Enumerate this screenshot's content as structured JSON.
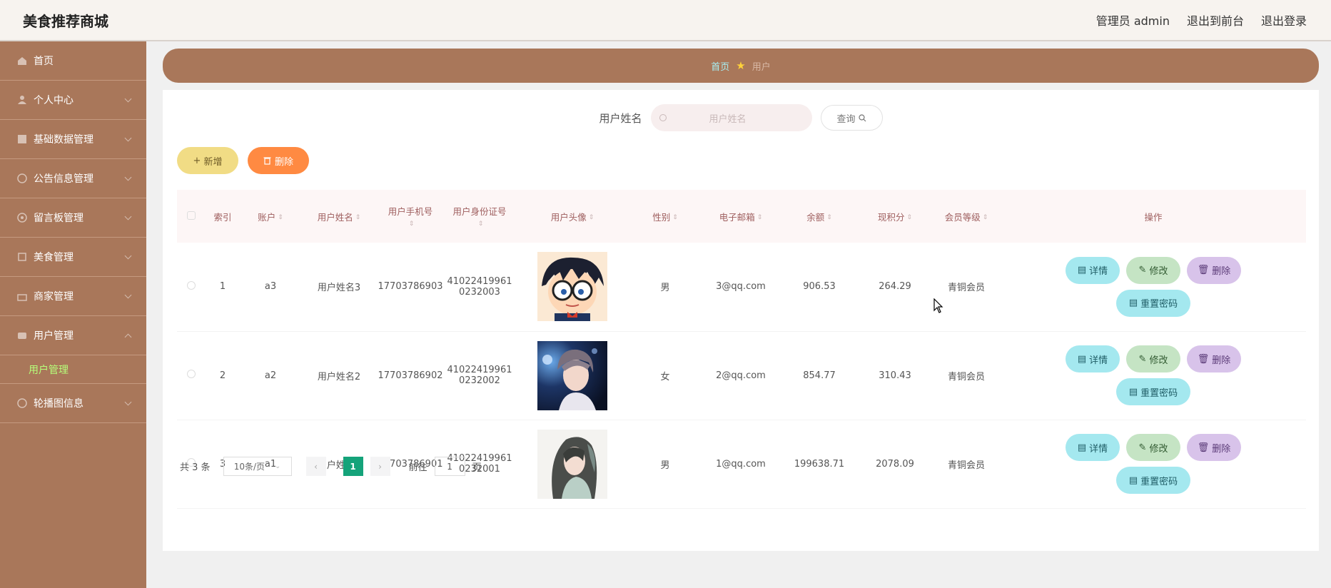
{
  "header": {
    "brand": "美食推荐商城",
    "admin_label": "管理员 admin",
    "back_to_front": "退出到前台",
    "logout": "退出登录"
  },
  "sidebar": {
    "items": [
      {
        "label": "首页",
        "icon": "home-icon"
      },
      {
        "label": "个人中心",
        "icon": "user-icon"
      },
      {
        "label": "基础数据管理",
        "icon": "database-icon"
      },
      {
        "label": "公告信息管理",
        "icon": "notice-icon"
      },
      {
        "label": "留言板管理",
        "icon": "message-icon"
      },
      {
        "label": "美食管理",
        "icon": "food-icon"
      },
      {
        "label": "商家管理",
        "icon": "shop-icon"
      },
      {
        "label": "用户管理",
        "icon": "users-icon"
      }
    ],
    "sub_item": "用户管理",
    "last_item": {
      "label": "轮播图信息",
      "icon": "carousel-icon"
    }
  },
  "breadcrumb": {
    "home": "首页",
    "current": "用户"
  },
  "search": {
    "label": "用户姓名",
    "placeholder": "用户姓名",
    "button": "查询"
  },
  "toolbar": {
    "add": "新增",
    "delete": "删除"
  },
  "table": {
    "headers": {
      "index": "索引",
      "account": "账户",
      "name": "用户姓名",
      "phone": "用户手机号",
      "idcard": "用户身份证号",
      "avatar": "用户头像",
      "gender": "性别",
      "email": "电子邮箱",
      "balance": "余额",
      "points": "现积分",
      "level": "会员等级",
      "ops": "操作"
    },
    "rows": [
      {
        "index": "1",
        "account": "a3",
        "name": "用户姓名3",
        "phone": "17703786903",
        "id1": "41022419961",
        "id2": "0232003",
        "gender": "男",
        "email": "3@qq.com",
        "balance": "906.53",
        "points": "264.29",
        "level": "青铜会员"
      },
      {
        "index": "2",
        "account": "a2",
        "name": "用户姓名2",
        "phone": "17703786902",
        "id1": "41022419961",
        "id2": "0232002",
        "gender": "女",
        "email": "2@qq.com",
        "balance": "854.77",
        "points": "310.43",
        "level": "青铜会员"
      },
      {
        "index": "3",
        "account": "a1",
        "name": "用户姓名1",
        "phone": "17703786901",
        "id1": "41022419961",
        "id2": "0232001",
        "gender": "男",
        "email": "1@qq.com",
        "balance": "199638.71",
        "points": "2078.09",
        "level": "青铜会员"
      }
    ],
    "actions": {
      "detail": "详情",
      "edit": "修改",
      "delete": "删除",
      "reset": "重置密码"
    }
  },
  "pagination": {
    "total": "共 3 条",
    "page_size": "10条/页",
    "current_page": "1",
    "goto_label": "前往",
    "goto_value": "1",
    "page_unit": "页"
  },
  "overlay": {
    "watermark": "<unclear>"
  },
  "colors": {
    "sidebar": "#a9775a",
    "accent_active": "#15a37a",
    "add_button": "#f1dc85",
    "delete_button": "#ff8a42"
  }
}
